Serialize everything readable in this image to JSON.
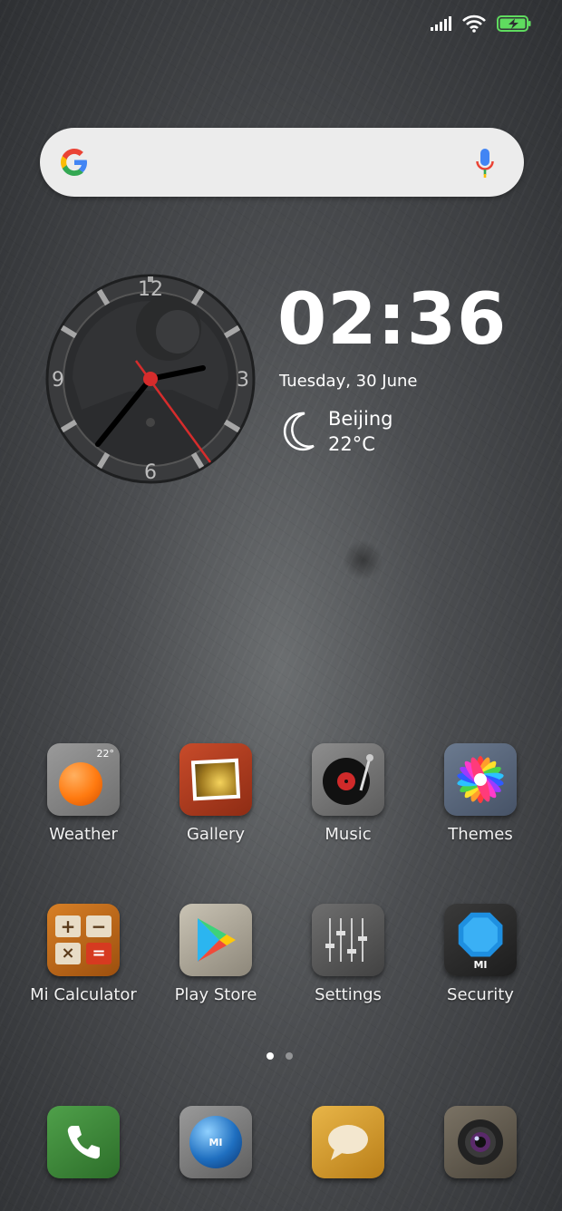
{
  "clock": {
    "time": "02:36",
    "date": "Tuesday, 30 June",
    "numerals": {
      "top": "12",
      "right": "3",
      "bottom": "6",
      "left": "9"
    }
  },
  "weather": {
    "city": "Beijing",
    "temp": "22°C",
    "icon": "moon-icon"
  },
  "apps": [
    {
      "label": "Weather",
      "icon": "weather-icon",
      "badge": "22°"
    },
    {
      "label": "Gallery",
      "icon": "gallery-icon"
    },
    {
      "label": "Music",
      "icon": "music-icon"
    },
    {
      "label": "Themes",
      "icon": "themes-icon"
    },
    {
      "label": "Mi Calculator",
      "icon": "calculator-icon"
    },
    {
      "label": "Play Store",
      "icon": "play-store-icon"
    },
    {
      "label": "Settings",
      "icon": "settings-icon"
    },
    {
      "label": "Security",
      "icon": "security-icon",
      "badge": "MI"
    }
  ],
  "dock": [
    {
      "icon": "phone-icon"
    },
    {
      "icon": "browser-icon",
      "badge": "MI"
    },
    {
      "icon": "messages-icon"
    },
    {
      "icon": "camera-icon"
    }
  ],
  "page_indicator": {
    "pages": 2,
    "current": 1
  }
}
